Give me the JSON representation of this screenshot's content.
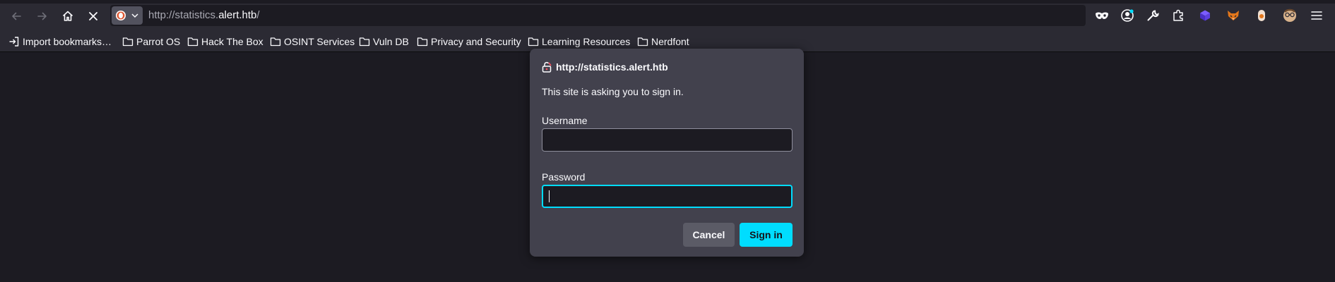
{
  "browser": {
    "url": {
      "prefix": "http://statistics.",
      "domain": "alert.htb",
      "suffix": "/"
    },
    "nav": {
      "back_icon": "back-arrow-icon",
      "forward_icon": "forward-arrow-icon",
      "home_icon": "home-icon",
      "stop_icon": "stop-loading-icon"
    },
    "search_engine_icon": "duckduckgo-icon",
    "extensions": [
      "private-mask-icon",
      "account-icon",
      "wrench-icon",
      "extensions-puzzle-icon",
      "purple-cube-extension-icon",
      "fox-extension-icon",
      "container-extension-icon",
      "profile-avatar-extension-icon",
      "menu-hamburger-icon"
    ]
  },
  "bookmarks": [
    {
      "label": "Import bookmarks…",
      "icon": "import-icon"
    },
    {
      "label": "Parrot OS",
      "icon": "folder-icon"
    },
    {
      "label": "Hack The Box",
      "icon": "folder-icon"
    },
    {
      "label": "OSINT Services",
      "icon": "folder-icon"
    },
    {
      "label": "Vuln DB",
      "icon": "folder-icon"
    },
    {
      "label": "Privacy and Security",
      "icon": "folder-icon"
    },
    {
      "label": "Learning Resources",
      "icon": "folder-icon"
    },
    {
      "label": "Nerdfont",
      "icon": "folder-icon"
    }
  ],
  "dialog": {
    "site": "http://statistics.alert.htb",
    "message": "This site is asking you to sign in.",
    "username_label": "Username",
    "username_value": "",
    "password_label": "Password",
    "password_value": "",
    "cancel_label": "Cancel",
    "signin_label": "Sign in",
    "lock_icon": "broken-lock-icon"
  },
  "colors": {
    "accent": "#00ddff",
    "toolbar": "#2b2a33",
    "page_bg": "#1c1b22",
    "dialog_bg": "#42414d"
  }
}
